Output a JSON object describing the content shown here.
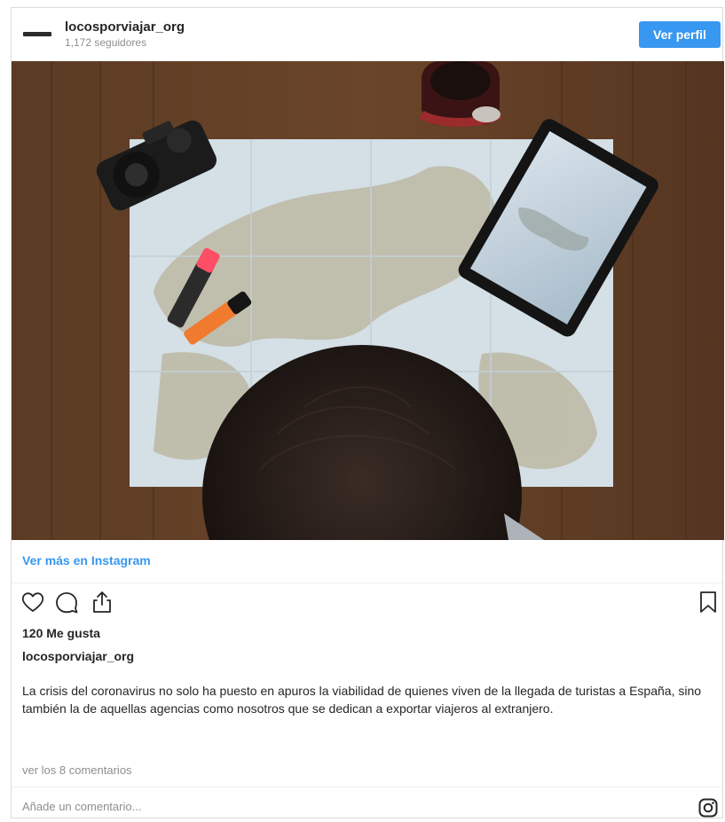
{
  "header": {
    "username": "locosporviajar_org",
    "followers": "1,172 seguidores",
    "view_profile_label": "Ver perfil"
  },
  "post": {
    "ver_mas_label": "Ver más en Instagram",
    "likes": "120 Me gusta",
    "caption_user": "locosporviajar_org",
    "caption": "La crisis del coronavirus no solo ha puesto en apuros la viabilidad de quienes viven de la llegada de turistas a España, sino también la de aquellas agencias como nosotros que se dedican a exportar viajeros al extranjero.",
    "comments_link": "ver los 8 comentarios",
    "comment_placeholder": "Añade un comentario..."
  },
  "icons": {
    "like": "heart-icon",
    "comment": "comment-bubble-icon",
    "share": "share-icon",
    "save": "bookmark-icon",
    "brand": "instagram-icon"
  },
  "colors": {
    "accent": "#3897f0",
    "text": "#262626",
    "muted": "#8e8e8e",
    "border": "#dbdbdb"
  }
}
